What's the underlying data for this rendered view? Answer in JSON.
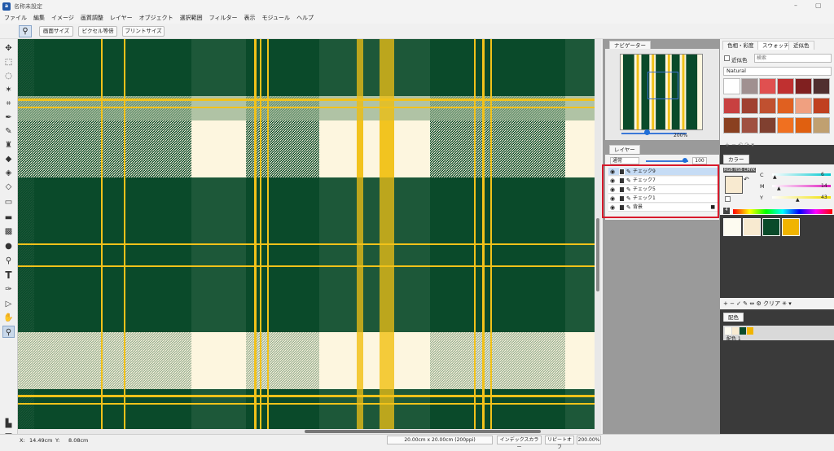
{
  "window": {
    "title": "名称未設定",
    "app_icon": "a",
    "min_glyph": "–",
    "max_glyph": "▢"
  },
  "menu": [
    "ファイル",
    "編集",
    "イメージ",
    "画質調整",
    "レイヤー",
    "オブジェクト",
    "選択範囲",
    "フィルター",
    "表示",
    "モジュール",
    "ヘルプ"
  ],
  "options_bar": {
    "buttons": [
      "画面サイズ",
      "ピクセル等倍",
      "プリントサイズ"
    ]
  },
  "tools": [
    "move",
    "rect-select",
    "lasso",
    "magic-wand",
    "crop",
    "eyedropper",
    "brush",
    "stamp",
    "eraser",
    "fill",
    "fill-pattern",
    "rect-shape",
    "image",
    "gradient",
    "blur",
    "dodge",
    "text",
    "pen",
    "path-select",
    "hand",
    "zoom"
  ],
  "navigator": {
    "tab": "ナビゲーター",
    "zoom": "200%"
  },
  "layers": {
    "tab": "レイヤー",
    "blend_mode": "通常",
    "opacity": "100",
    "items": [
      {
        "name": "チェック9",
        "selected": true,
        "locked": false
      },
      {
        "name": "チェック7",
        "selected": false,
        "locked": false
      },
      {
        "name": "チェック5",
        "selected": false,
        "locked": false
      },
      {
        "name": "チェック1",
        "selected": false,
        "locked": false
      },
      {
        "name": "背景",
        "selected": false,
        "locked": true
      }
    ]
  },
  "swatch_panel": {
    "tabs": [
      "色相・彩度",
      "スウォッチ",
      "近似色"
    ],
    "checkbox_label": "近似色",
    "search_placeholder": "検索",
    "preset": "Natural",
    "colors": [
      "#ffffff",
      "#a09090",
      "#e05050",
      "#c03030",
      "#802020",
      "#503030",
      "#c84040",
      "#a04030",
      "#c05030",
      "#e06020",
      "#f0a080",
      "#c04020",
      "#8a4020",
      "#a05040",
      "#804030",
      "#f07020",
      "#e06010",
      "#c0a070"
    ],
    "tool_glyphs": "+ − ↶ ↷ ▾"
  },
  "color_panel": {
    "tab": "カラー",
    "modes": "RGB HSB CMYK",
    "channels": [
      {
        "label": "C",
        "value": "6"
      },
      {
        "label": "M",
        "value": "14"
      },
      {
        "label": "Y",
        "value": "43"
      }
    ],
    "fg_color": "#f8ead0",
    "bg_color": "#ffffff"
  },
  "palette": {
    "colors": [
      "#fdfbf0",
      "#f8ead0",
      "#0a4a2a",
      "#f0b400"
    ],
    "toolbar_text": "+ − ✓ ✎ ⇔ ⚙ クリア ✳ ▾"
  },
  "color_scheme": {
    "tab": "配色",
    "name": "配色 1",
    "colors": [
      "#fdfbf0",
      "#f8ead0",
      "#0a4a2a",
      "#f0b400"
    ]
  },
  "status": {
    "x_label": "X:",
    "x": "14.49cm",
    "y_label": "Y:",
    "y": "8.08cm",
    "doc_size": "20.00cm x 20.00cm (200ppi)",
    "index_color_button": "インデックスカラー",
    "repeat_button": "リピートオフ",
    "zoom": "200.00%"
  },
  "tartan": {
    "green": "#0a4a2a",
    "cream": "#fdf6df",
    "yellow": "#f2c21a",
    "mid": "#8fae8c"
  }
}
